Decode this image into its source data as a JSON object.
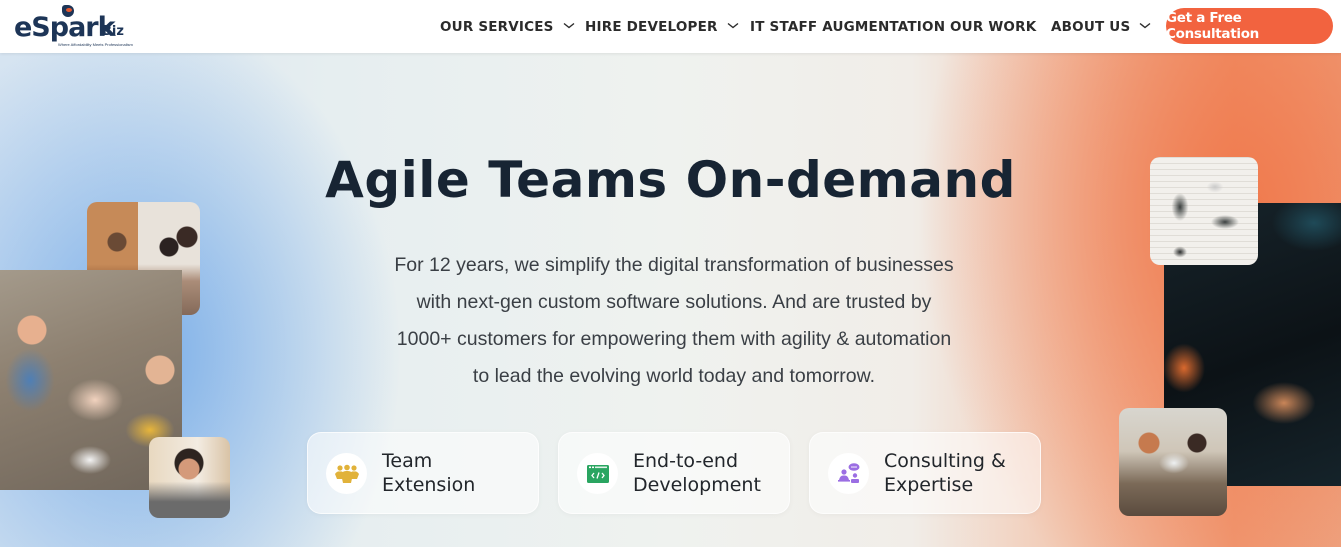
{
  "brand": {
    "name": "eSpark",
    "suffix": "Biz",
    "tagline": "Where Affordability Meets Professionalism"
  },
  "nav": {
    "items": [
      {
        "label": "OUR SERVICES",
        "has_dropdown": true
      },
      {
        "label": "HIRE DEVELOPER",
        "has_dropdown": true
      },
      {
        "label": "IT STAFF AUGMENTATION",
        "has_dropdown": false
      },
      {
        "label": "OUR WORK",
        "has_dropdown": false
      },
      {
        "label": "ABOUT US",
        "has_dropdown": true
      }
    ],
    "cta_label": "Get a Free Consultation"
  },
  "hero": {
    "title": "Agile Teams On-demand",
    "description": "For 12 years, we simplify the digital transformation of businesses with next-gen custom software solutions. And are trusted by 1000+ customers for empowering them with agility & automation to lead the evolving world today and tomorrow.",
    "description_lines": [
      "For 12 years, we simplify the digital transformation of businesses",
      "with next-gen custom software solutions. And are trusted by",
      "1000+ customers for empowering them with agility & automation",
      "to lead the evolving world today and tomorrow."
    ],
    "cards": [
      {
        "label": "Team\nExtension",
        "icon": "team-icon",
        "icon_color": "#e1b23a"
      },
      {
        "label": "End-to-end\nDevelopment",
        "icon": "code-window-icon",
        "icon_color": "#2aa561"
      },
      {
        "label": "Consulting &\nExpertise",
        "icon": "consulting-icon",
        "icon_color": "#9b6ee3"
      }
    ],
    "images": {
      "left": [
        "team-meeting-photo",
        "team-hands-stack-photo",
        "colleagues-reading-photo"
      ],
      "right": [
        "laptops-overhead-photo",
        "hands-together-photo",
        "coworkers-laptops-photo"
      ]
    }
  },
  "colors": {
    "accent": "#f2633f",
    "heading": "#172433",
    "brand_navy": "#1d3557",
    "bg_blue": "#74aae8",
    "bg_orange": "#f0784b"
  }
}
